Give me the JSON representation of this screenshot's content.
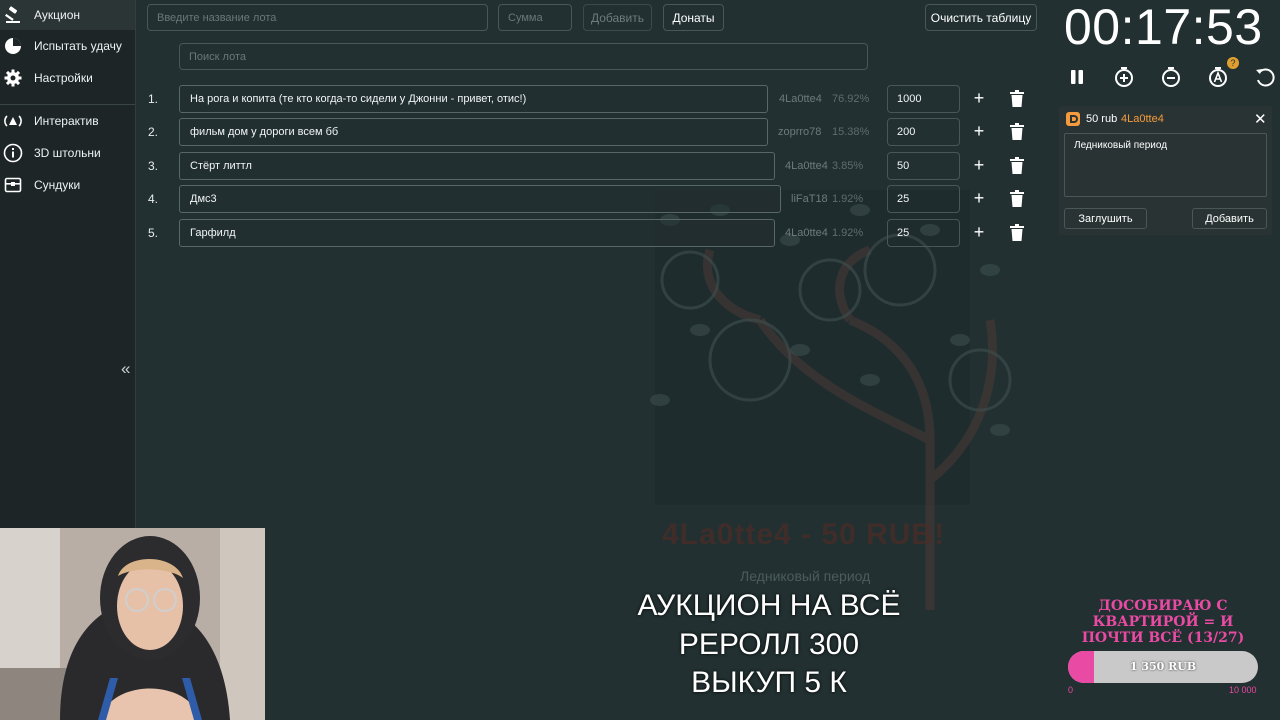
{
  "sidebar": {
    "items": [
      {
        "label": "Аукцион",
        "icon": "gavel-icon",
        "active": true
      },
      {
        "label": "Испытать удачу",
        "icon": "pie-chart-icon",
        "active": false
      },
      {
        "label": "Настройки",
        "icon": "gear-icon",
        "active": false
      },
      {
        "label": "Интерактив",
        "icon": "broadcast-icon",
        "active": false
      },
      {
        "label": "3D штольни",
        "icon": "info-icon",
        "active": false
      },
      {
        "label": "Сундуки",
        "icon": "chest-icon",
        "active": false
      }
    ],
    "collapse_label": "«"
  },
  "toolbar": {
    "lot_name_placeholder": "Введите название лота",
    "amount_placeholder": "Сумма",
    "add_label": "Добавить",
    "donations_label": "Донаты",
    "clear_label": "Очистить таблицу"
  },
  "search": {
    "placeholder": "Поиск лота"
  },
  "lots": [
    {
      "num": "1.",
      "name": "На рога и копита (те кто когда-то сидели у Джонни - привет, отис!)",
      "donor": "4La0tte4",
      "percent": "76.92%",
      "amount": "1000"
    },
    {
      "num": "2.",
      "name": "фильм дом у дороги всем бб",
      "donor": "zoprro78",
      "percent": "15.38%",
      "amount": "200"
    },
    {
      "num": "3.",
      "name": "Стёрт литтл",
      "donor": "4La0tte4",
      "percent": "3.85%",
      "amount": "50"
    },
    {
      "num": "4.",
      "name": "Дмс3",
      "donor": "liFaT18",
      "percent": "1.92%",
      "amount": "25"
    },
    {
      "num": "5.",
      "name": "Гарфилд",
      "donor": "4La0tte4",
      "percent": "1.92%",
      "amount": "25"
    }
  ],
  "timer": {
    "value": "00:17:53",
    "controls": [
      "pause-icon",
      "add-time-icon",
      "subtract-time-icon",
      "auto-timer-icon",
      "reset-icon"
    ],
    "help_badge": "?"
  },
  "donation": {
    "amount": "50 rub",
    "user": "4La0tte4",
    "message": "Ледниковый период",
    "mute_label": "Заглушить",
    "add_label": "Добавить",
    "close_label": "✕"
  },
  "background": {
    "donor_text": "4La0tte4 - 50 RUB!",
    "lot_text": "Ледниковый период"
  },
  "overlay": {
    "lines": [
      "АУКЦИОН НА ВСЁ",
      "РЕРОЛЛ 300",
      "ВЫКУП 5 К"
    ]
  },
  "goal": {
    "title": "ДОСОБИРАЮ С КВАРТИРОЙ = И ПОЧТИ ВСЁ (13/27)",
    "current": "1 350 RUB",
    "min": "0",
    "max": "10 000",
    "progress": 0.135
  },
  "colors": {
    "background": "#223031",
    "sidebar": "#1d2526",
    "accent_orange": "#f59b3d",
    "goal_pink": "#e94aa3"
  }
}
